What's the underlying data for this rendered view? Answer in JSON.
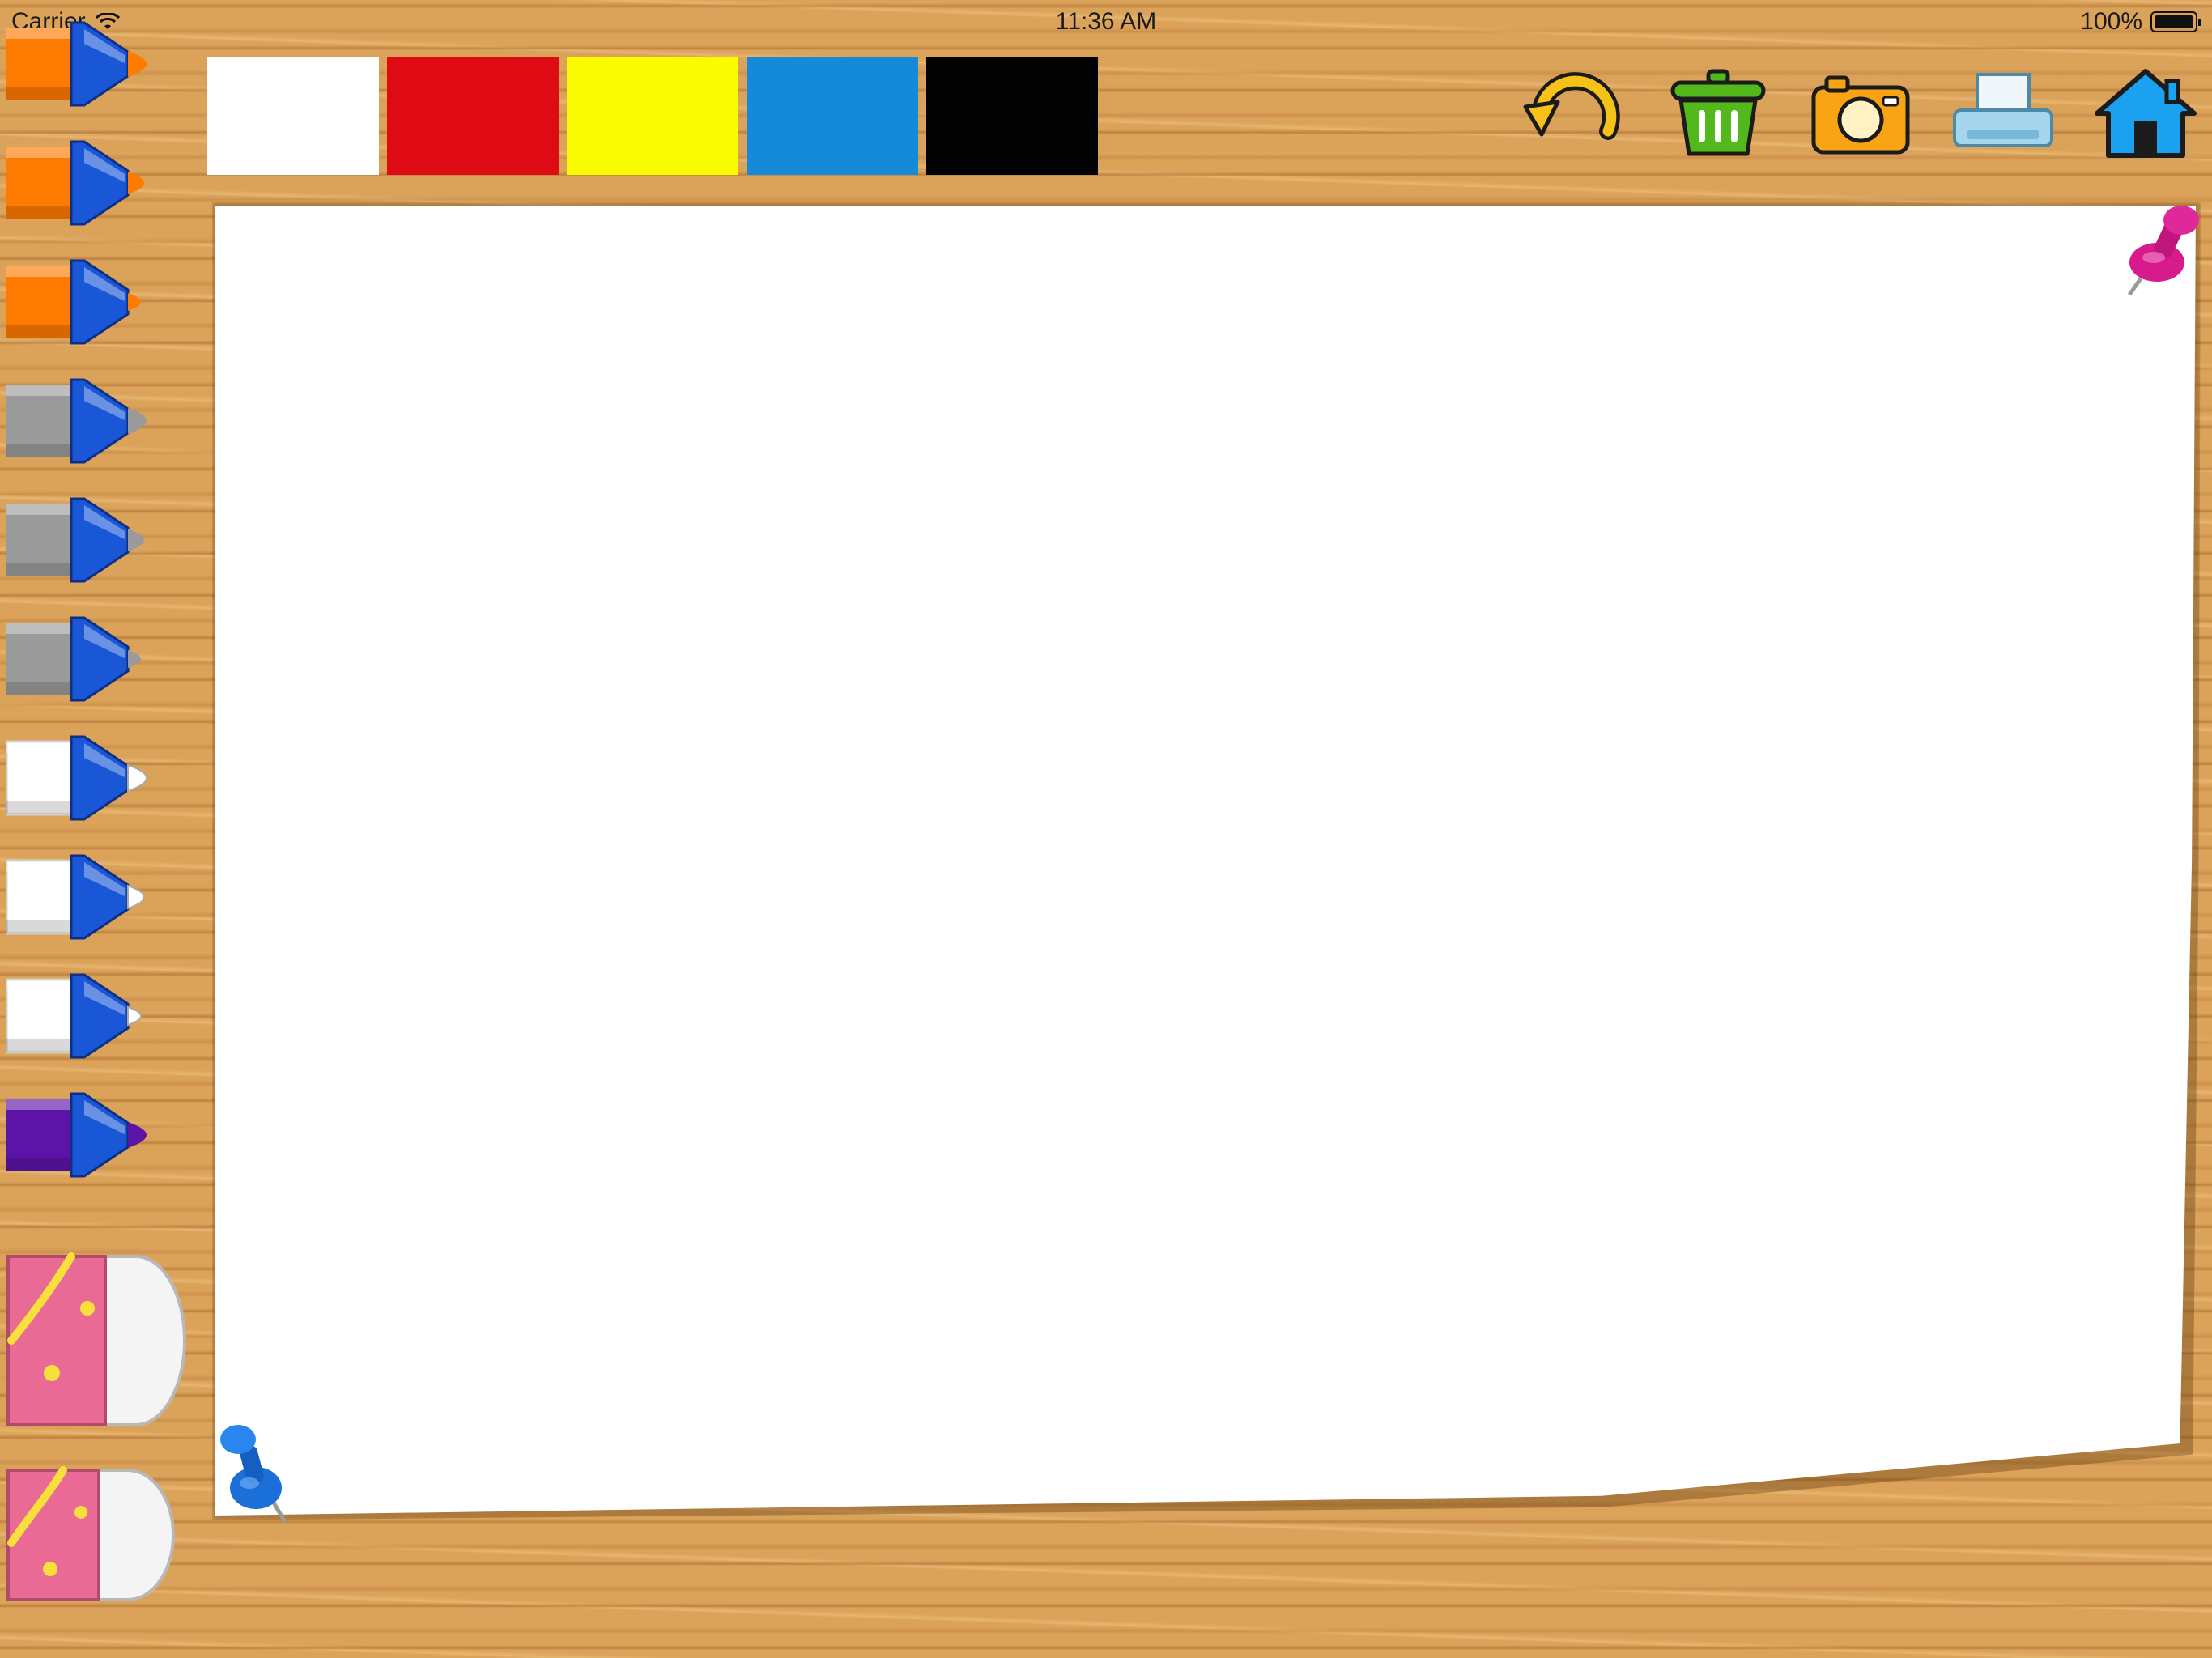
{
  "status_bar": {
    "carrier": "Carrier",
    "time": "11:36 AM",
    "battery": "100%",
    "battery_level_percent": 100
  },
  "palette": {
    "swatches": [
      {
        "name": "white",
        "color": "#ffffff"
      },
      {
        "name": "red",
        "color": "#de0a14"
      },
      {
        "name": "yellow",
        "color": "#fbfb00"
      },
      {
        "name": "blue",
        "color": "#148ad9"
      },
      {
        "name": "black",
        "color": "#020202"
      }
    ]
  },
  "toolbar": {
    "buttons": [
      {
        "name": "undo-button",
        "icon": "undo-icon"
      },
      {
        "name": "trash-button",
        "icon": "trash-icon"
      },
      {
        "name": "camera-button",
        "icon": "camera-icon"
      },
      {
        "name": "print-button",
        "icon": "printer-icon"
      },
      {
        "name": "home-button",
        "icon": "home-icon"
      }
    ]
  },
  "markers": [
    {
      "name": "marker-orange-large",
      "color": "#ff7a00",
      "size": "large"
    },
    {
      "name": "marker-orange-medium",
      "color": "#ff7a00",
      "size": "medium"
    },
    {
      "name": "marker-orange-small",
      "color": "#ff7a00",
      "size": "small"
    },
    {
      "name": "marker-gray-large",
      "color": "#9a9a9a",
      "size": "large"
    },
    {
      "name": "marker-gray-medium",
      "color": "#9a9a9a",
      "size": "medium"
    },
    {
      "name": "marker-gray-small",
      "color": "#9a9a9a",
      "size": "small"
    },
    {
      "name": "marker-white-large",
      "color": "#ffffff",
      "size": "large"
    },
    {
      "name": "marker-white-medium",
      "color": "#ffffff",
      "size": "medium"
    },
    {
      "name": "marker-white-small",
      "color": "#ffffff",
      "size": "small"
    },
    {
      "name": "marker-purple-large",
      "color": "#5c14a6",
      "size": "large"
    }
  ],
  "erasers": [
    {
      "name": "eraser-large",
      "size": "large"
    },
    {
      "name": "eraser-small",
      "size": "small"
    }
  ],
  "colors": {
    "wood": "#dba25a",
    "paper": "#ffffff",
    "marker_body_blue": "#1a57d6",
    "pin_magenta": "#d81b8c",
    "pin_blue": "#1a6fd8",
    "eraser_pink": "#e96a94"
  }
}
